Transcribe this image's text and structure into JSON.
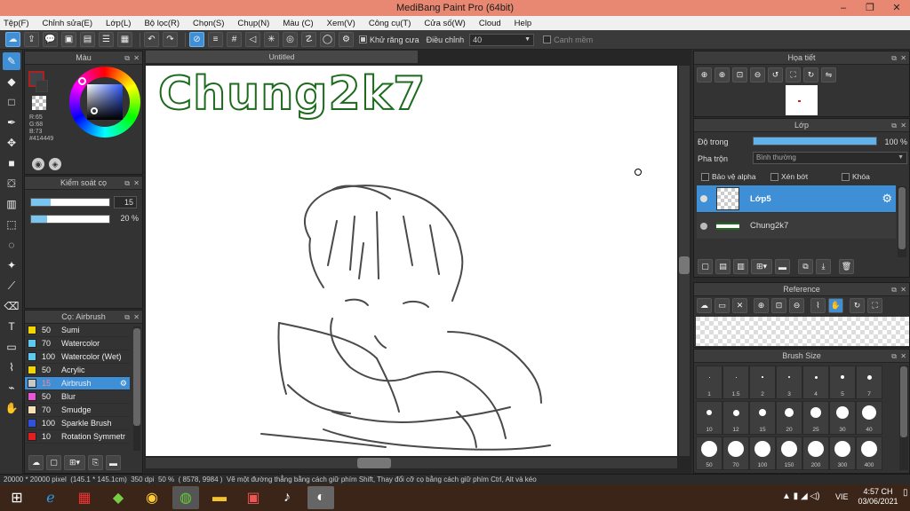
{
  "window": {
    "title": "MediBang Paint Pro (64bit)"
  },
  "menu": [
    "Tệp(F)",
    "Chỉnh sửa(E)",
    "Lớp(L)",
    "Bộ lọc(R)",
    "Chọn(S)",
    "Chụp(N)",
    "Màu (C)",
    "Xem(V)",
    "Công cụ(T)",
    "Cửa số(W)",
    "Cloud",
    "Help"
  ],
  "toolbar": {
    "antialias_label": "Khử răng cưa",
    "adjust_label": "Điều chỉnh",
    "adjust_value": "40",
    "smooth_label": "Canh mềm"
  },
  "color_panel": {
    "title": "Màu",
    "r": "R:65",
    "g": "G:68",
    "b": "B:73",
    "hex": "#414449",
    "primary": "#414449",
    "accent": "#3f8fd6"
  },
  "brush_control": {
    "title": "Kiểm soát cọ",
    "size_value": "15",
    "opacity_value": "20 %",
    "size_fraction": 0.25,
    "opacity_fraction": 0.2
  },
  "brush_list": {
    "title": "Cọ: Airbrush",
    "items": [
      {
        "size": "50",
        "name": "Sumi",
        "color": "#f2d600",
        "selected": false
      },
      {
        "size": "70",
        "name": "Watercolor",
        "color": "#5ec8ef",
        "selected": false
      },
      {
        "size": "100",
        "name": "Watercolor (Wet)",
        "color": "#5ec8ef",
        "selected": false
      },
      {
        "size": "50",
        "name": "Acrylic",
        "color": "#f2d600",
        "selected": false
      },
      {
        "size": "15",
        "name": "Airbrush",
        "color": "#c8c8c8",
        "selected": true
      },
      {
        "size": "50",
        "name": "Blur",
        "color": "#e857d6",
        "selected": false
      },
      {
        "size": "70",
        "name": "Smudge",
        "color": "#f5e1b5",
        "selected": false
      },
      {
        "size": "100",
        "name": "Sparkle Brush",
        "color": "#3050e0",
        "selected": false
      },
      {
        "size": "10",
        "name": "Rotation Symmetr",
        "color": "#e02020",
        "selected": false
      }
    ]
  },
  "canvas": {
    "tab": "Untitled",
    "text": "Chung2k7",
    "text_color": "#1c6b1c"
  },
  "navigator": {
    "title": "Họa tiết"
  },
  "layers": {
    "title": "Lớp",
    "opacity_label": "Độ trong",
    "opacity_value": "100 %",
    "opacity_fraction": 1.0,
    "blend_label": "Pha trộn",
    "blend_value": "Bình thường",
    "protect_alpha": "Bảo vệ alpha",
    "clipping": "Xén bớt",
    "lock": "Khóa",
    "items": [
      {
        "name": "Lớp5",
        "selected": true
      },
      {
        "name": "Chung2k7",
        "selected": false
      }
    ]
  },
  "reference": {
    "title": "Reference"
  },
  "brush_size": {
    "title": "Brush Size",
    "sizes": [
      "1",
      "1.5",
      "2",
      "3",
      "4",
      "5",
      "7",
      "10",
      "12",
      "15",
      "20",
      "25",
      "30",
      "40",
      "50",
      "70",
      "100",
      "150",
      "200",
      "300",
      "400"
    ]
  },
  "status": {
    "size": "20000 * 20000 pixel",
    "cm": "(145.1 * 145.1cm)",
    "dpi": "350 dpi",
    "zoom": "50 %",
    "coords": "( 8578, 9984 )",
    "hint": "Vẽ một đường thẳng bằng cách giữ phím Shift, Thay đổi cỡ cọ bằng cách giữ phím Ctrl, Alt và kéo"
  },
  "taskbar": {
    "lang": "VIE",
    "time": "4:57 CH",
    "date": "03/06/2021"
  }
}
